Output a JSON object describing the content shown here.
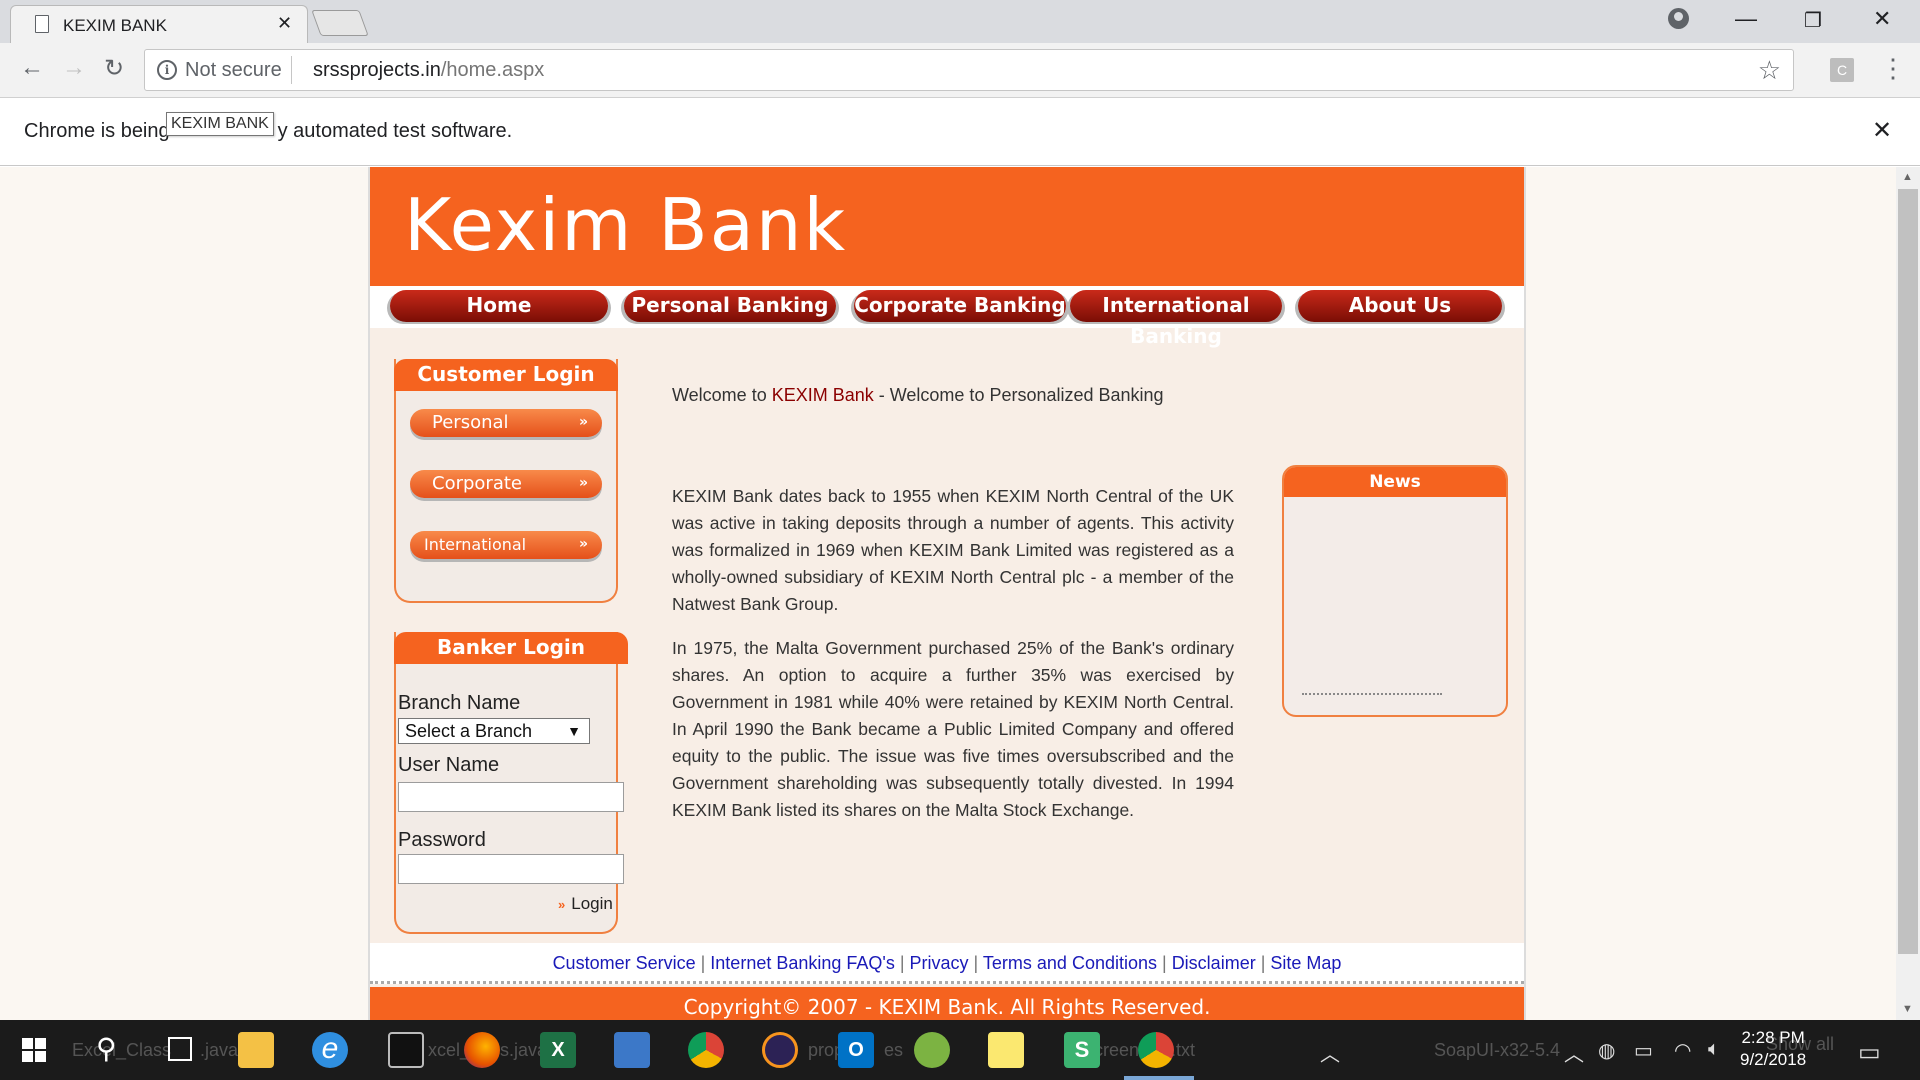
{
  "browser": {
    "tab_title": "KEXIM BANK",
    "security_label": "Not secure",
    "url_host": "srssprojects.in",
    "url_path": "/home.aspx",
    "infobar_before": "Chrome is being",
    "infobar_after": "y automated test software.",
    "tooltip": "KEXIM BANK",
    "extension_letter": "C"
  },
  "site": {
    "banner_title": "Kexim Bank",
    "nav": [
      "Home",
      "Personal Banking",
      "Corporate Banking",
      "International Banking",
      "About Us"
    ],
    "customer_login": {
      "title": "Customer Login",
      "buttons": [
        "Personal",
        "Corporate",
        "International"
      ]
    },
    "banker_login": {
      "title": "Banker Login",
      "branch_label": "Branch Name",
      "branch_selected": "Select a Branch",
      "username_label": "User Name",
      "password_label": "Password",
      "login_label": "Login"
    },
    "welcome": {
      "prefix": "Welcome to ",
      "brand": "KEXIM Bank",
      "suffix": " - Welcome to Personalized Banking"
    },
    "paragraphs": [
      "KEXIM Bank dates back to 1955 when KEXIM North Central of the UK was active in taking deposits through a number of agents. This activity was formalized in 1969 when KEXIM Bank Limited was registered as a wholly-owned subsidiary of KEXIM North Central plc - a member of the Natwest Bank Group.",
      "In 1975, the Malta Government purchased 25% of the Bank's ordinary shares. An option to acquire a further 35% was exercised by Government in 1981 while 40% were retained by KEXIM North Central. In April 1990 the Bank became a Public Limited Company and offered equity to the public. The issue was five times oversubscribed and the Government shareholding was subsequently totally divested. In 1994 KEXIM Bank listed its shares on the Malta Stock Exchange."
    ],
    "news_title": "News",
    "footer_links": [
      "Customer Service",
      "Internet Banking FAQ's",
      "Privacy",
      "Terms and Conditions",
      "Disclaimer",
      "Site Map"
    ],
    "copyright": "Copyright© 2007 - KEXIM Bank. All Rights Reserved."
  },
  "taskbar": {
    "ghost_labels": [
      "Excel_Class",
      ".java",
      "xcel_",
      "s.java",
      "prop",
      "es",
      "creen",
      "t.txt",
      "SoapUI-x32-5.4",
      "Show all"
    ],
    "time": "2:28 PM",
    "date": "9/2/2018"
  },
  "colors": {
    "brand_orange": "#f5631f",
    "nav_red": "#a8180c",
    "link_blue": "#1a1ab8",
    "brand_text": "#8b0000"
  }
}
